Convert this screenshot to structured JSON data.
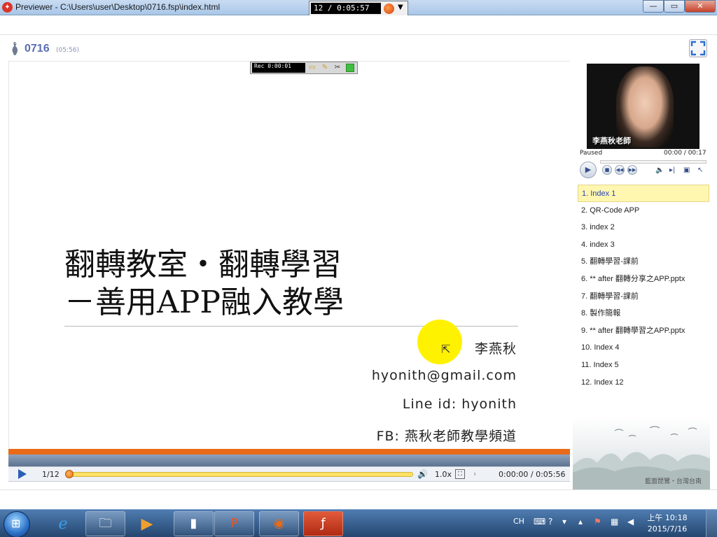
{
  "window": {
    "title": "Previewer - C:\\Users\\user\\Desktop\\0716.fsp\\index.html",
    "recorder_counter": "12 / 0:05:57"
  },
  "course": {
    "title": "0716",
    "duration": "(05:56)"
  },
  "recording_toolbar": {
    "label": "Rec 0:00:01"
  },
  "slide": {
    "title_line1": "翻轉教室・翻轉學習",
    "title_line2": "－善用APP融入教學",
    "author": "李燕秋",
    "email": "hyonith@gmail.com",
    "line_id": "Line id: hyonith",
    "fb": "FB: 燕秋老師教學頻道"
  },
  "player": {
    "page": "1/12",
    "speed": "1.0x",
    "time": "0:00:00 / 0:05:56",
    "progress": 0
  },
  "video": {
    "presenter_name": "李燕秋老師",
    "status": "Paused",
    "time": "00:00 / 00:17"
  },
  "index": {
    "items": [
      {
        "label": "1. Index 1",
        "active": true
      },
      {
        "label": "2. QR-Code APP",
        "active": false
      },
      {
        "label": "3. index 2",
        "active": false
      },
      {
        "label": "4. index 3",
        "active": false
      },
      {
        "label": "5. 翻轉學習-課前",
        "active": false
      },
      {
        "label": "6. ** after 翻轉分享之APP.pptx",
        "active": false
      },
      {
        "label": "7. 翻轉學習-課前",
        "active": false
      },
      {
        "label": "8. 製作簡報",
        "active": false
      },
      {
        "label": "9. ** after 翻轉學習之APP.pptx",
        "active": false
      },
      {
        "label": "10. Index 4",
        "active": false
      },
      {
        "label": "11. Index 5",
        "active": false
      },
      {
        "label": "12. Index 12",
        "active": false
      }
    ]
  },
  "landscape": {
    "caption": "藍面琵鷺・台灣台南"
  },
  "taskbar": {
    "language": "CH",
    "time": "上午 10:18",
    "date": "2015/7/16"
  },
  "colors": {
    "accent_orange": "#e96a17",
    "highlight_yellow": "#fff200",
    "title_blue": "#5a6fb0",
    "active_index_bg": "#fff6b0"
  }
}
